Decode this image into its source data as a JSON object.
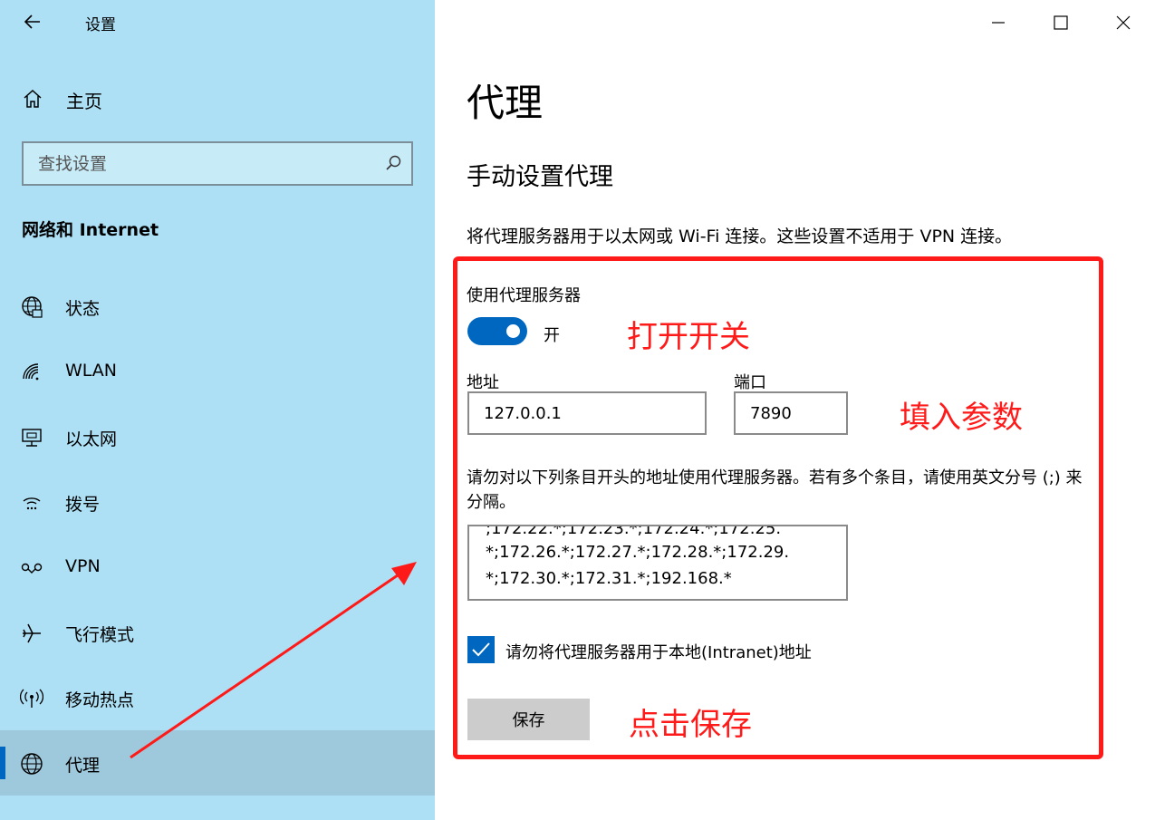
{
  "window": {
    "title": "设置",
    "minimize_icon": "minimize-icon",
    "maximize_icon": "maximize-icon",
    "close_icon": "close-icon"
  },
  "sidebar": {
    "home_label": "主页",
    "search_placeholder": "查找设置",
    "section_heading": "网络和 Internet",
    "items": [
      {
        "label": "状态",
        "icon": "globe-status-icon",
        "selected": false
      },
      {
        "label": "WLAN",
        "icon": "wifi-icon",
        "selected": false
      },
      {
        "label": "以太网",
        "icon": "ethernet-icon",
        "selected": false
      },
      {
        "label": "拨号",
        "icon": "dialup-icon",
        "selected": false
      },
      {
        "label": "VPN",
        "icon": "vpn-icon",
        "selected": false
      },
      {
        "label": "飞行模式",
        "icon": "airplane-icon",
        "selected": false
      },
      {
        "label": "移动热点",
        "icon": "hotspot-icon",
        "selected": false
      },
      {
        "label": "代理",
        "icon": "globe-icon",
        "selected": true
      }
    ]
  },
  "main": {
    "page_title": "代理",
    "section_title": "手动设置代理",
    "description": "将代理服务器用于以太网或 Wi-Fi 连接。这些设置不适用于 VPN 连接。",
    "use_proxy_label": "使用代理服务器",
    "toggle_state": "开",
    "address_label": "地址",
    "address_value": "127.0.0.1",
    "port_label": "端口",
    "port_value": "7890",
    "exclusions_description": "请勿对以下列条目开头的地址使用代理服务器。若有多个条目，请使用英文分号 (;) 来分隔。",
    "exclusions_lines": [
      ";172.22.*;172.23.*;172.24.*;172.25.",
      "*;172.26.*;172.27.*;172.28.*;172.29.",
      "*;172.30.*;172.31.*;192.168.*"
    ],
    "bypass_local_label": "请勿将代理服务器用于本地(Intranet)地址",
    "bypass_local_checked": true,
    "save_label": "保存"
  },
  "annotations": {
    "toggle_note": "打开开关",
    "fields_note": "填入参数",
    "save_note": "点击保存"
  },
  "colors": {
    "accent": "#0067c0",
    "sidebar_bg": "#ade0f5",
    "annotation": "#ff1a1a"
  }
}
